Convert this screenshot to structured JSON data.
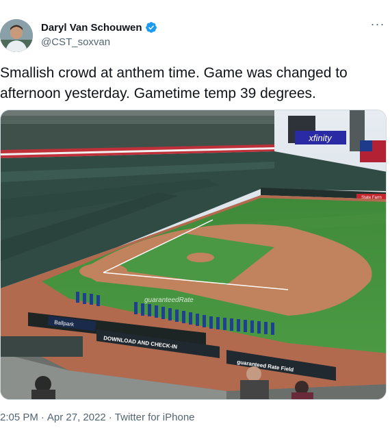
{
  "author": {
    "display_name": "Daryl Van Schouwen",
    "handle": "@CST_soxvan",
    "verified": true,
    "avatar_icon": "profile-photo"
  },
  "more_icon": "more-horizontal-icon",
  "tweet": {
    "text": "Smallish crowd at anthem time. Game was changed to afternoon yesterday. Gametime temp 39 degrees."
  },
  "media": {
    "signs": {
      "xfinity": "xfinity",
      "guaranteed_rate": "guaranteedRate",
      "download": "DOWNLOAD AND CHECK-IN",
      "field": "guaranteed Rate Field",
      "state_farm": "State Farm",
      "ballpark": "Ballpark"
    }
  },
  "meta": {
    "time": "2:05 PM",
    "date": "Apr 27, 2022",
    "client": "Twitter for iPhone",
    "separator": "·"
  },
  "colors": {
    "verified": "#1d9bf0",
    "secondary_text": "#536471",
    "primary_text": "#0f1419",
    "border": "#cfd9de"
  }
}
